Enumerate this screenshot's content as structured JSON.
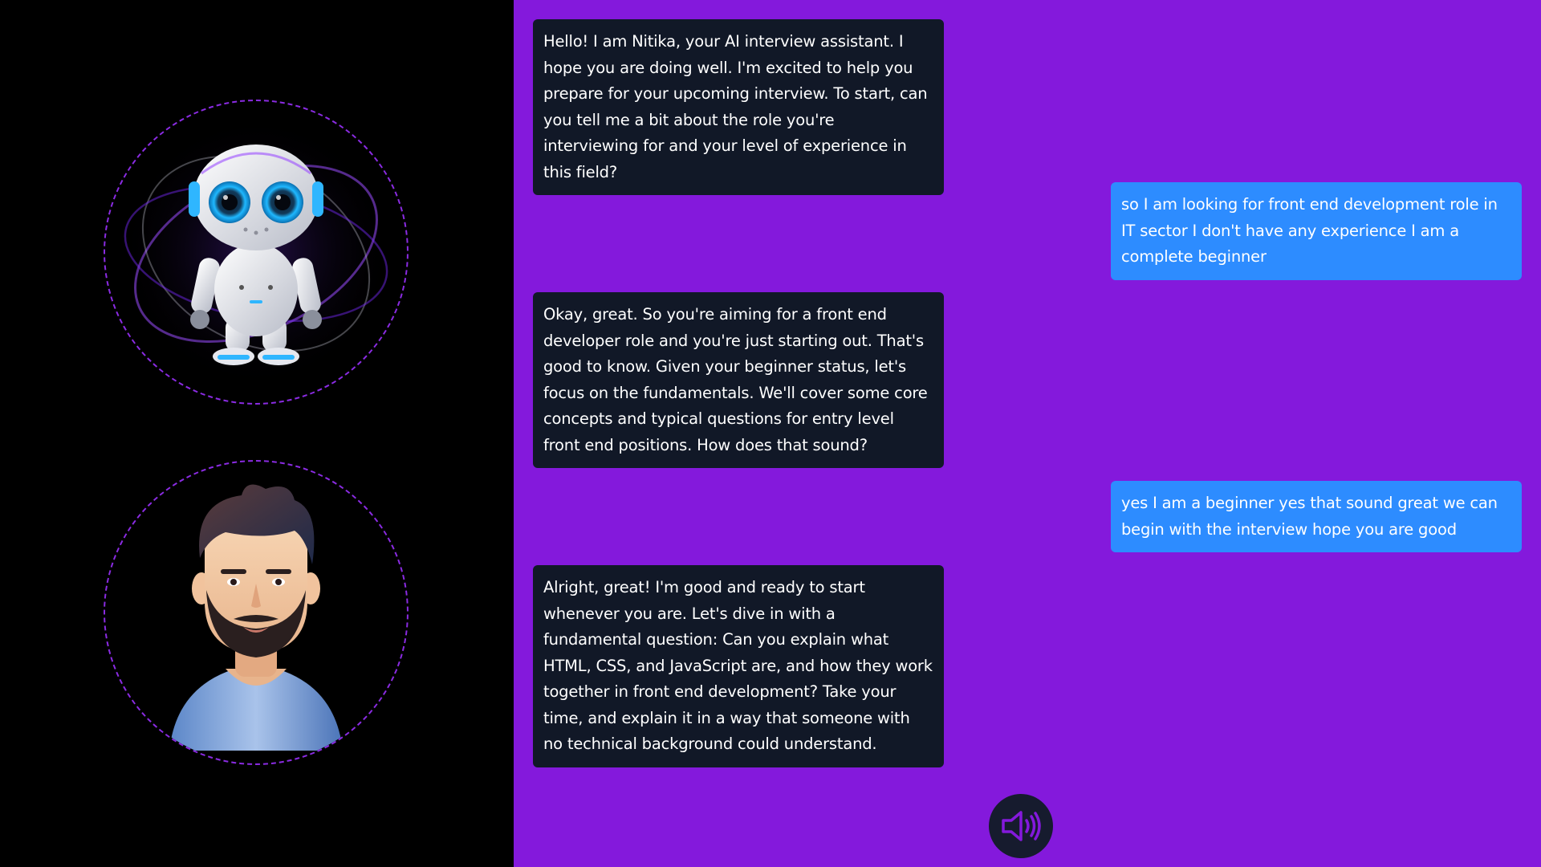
{
  "conversation": {
    "messages": [
      {
        "role": "ai",
        "text": "Hello! I am Nitika, your AI interview assistant. I hope you are doing well. I'm excited to help you prepare for your upcoming interview. To start, can you tell me a bit about the role you're interviewing for and your level of experience in this field?"
      },
      {
        "role": "user",
        "text": "so I am looking for front end development role in IT sector I don't have any experience I am a complete beginner"
      },
      {
        "role": "ai",
        "text": "Okay, great. So you're aiming for a front end developer role and you're just starting out. That's good to know. Given your beginner status, let's focus on the fundamentals. We'll cover some core concepts and typical questions for entry level front end positions. How does that sound?"
      },
      {
        "role": "user",
        "text": "yes I am a beginner yes that sound great we can begin with the interview hope you are good"
      },
      {
        "role": "ai",
        "text": "Alright, great! I'm good and ready to start whenever you are. Let's dive in with a fundamental question: Can you explain what HTML, CSS, and JavaScript are, and how they work together in front end development? Take your time, and explain it in a way that someone with no technical background could understand."
      }
    ]
  },
  "avatars": {
    "ai_icon": "robot-icon",
    "user_icon": "bearded-man-avatar-icon"
  },
  "controls": {
    "speaker_icon": "speaker-volume-icon"
  },
  "colors": {
    "left_bg": "#000000",
    "chat_bg": "#8419dc",
    "ai_bubble": "#111827",
    "user_bubble": "#2d8cff",
    "ring": "#8a2be2"
  }
}
